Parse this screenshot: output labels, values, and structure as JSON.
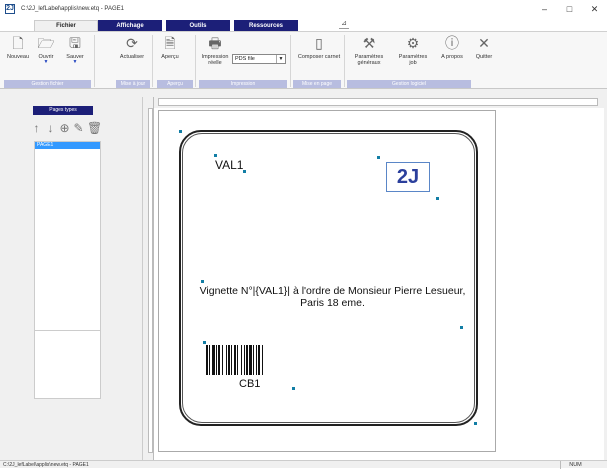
{
  "window": {
    "title": "C:\\2J_lefLabel\\applis\\new.etq - PAGE1",
    "app_icon": "2J",
    "minimize": "–",
    "maximize": "□",
    "close": "✕"
  },
  "tabs": [
    {
      "label": "Fichier",
      "active": true
    },
    {
      "label": "Affichage",
      "active": false
    },
    {
      "label": "Outils",
      "active": false
    },
    {
      "label": "Ressources",
      "active": false
    }
  ],
  "ribbon": {
    "buttons": {
      "nouveau": "Nouveau",
      "ouvrir": "Ouvrir",
      "sauver": "Sauver",
      "actualiser": "Actualiser",
      "apercu": "Aperçu",
      "impression": "Impression\nréelle",
      "composer": "Composer carnet",
      "param_generaux": "Paramètres\ngénéraux",
      "param_job": "Paramètres\njob",
      "apropos": "A propos",
      "quitter": "Quitter"
    },
    "printer_select": "PDS file",
    "groups": {
      "gestion_fichier": "Gestion fichier",
      "mise_a_jour": "Mise à jour",
      "apercu": "Aperçu",
      "impression": "Impression",
      "mise_en_page": "Mise en page",
      "gestion_logiciel": "Gestion logiciel"
    }
  },
  "left_pane": {
    "header": "Pages types",
    "pages": [
      "PAGE1"
    ]
  },
  "label": {
    "val1": "VAL1",
    "logo": "2J",
    "text": "Vignette N°|{VAL1}| à l'ordre de Monsieur Pierre Lesueur, Paris 18 eme.",
    "barcode_caption": "CB1"
  },
  "status": {
    "path": "C:\\2J_lefLabel\\applis\\new.etq - PAGE1",
    "num": "NUM"
  }
}
